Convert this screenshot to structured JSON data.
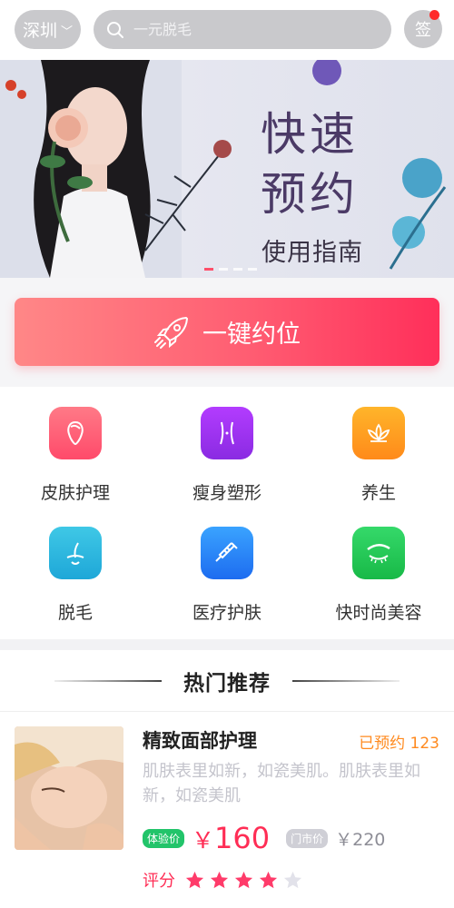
{
  "topbar": {
    "city": "深圳",
    "search_placeholder": "一元脱毛",
    "sign_label": "签"
  },
  "banner": {
    "line1": "快速",
    "line2": "预约",
    "line3": "使用指南",
    "slide_count": 4,
    "active_slide": 0
  },
  "book_button": {
    "label": "一键约位"
  },
  "categories": [
    {
      "label": "皮肤护理",
      "icon": "face-icon",
      "color_from": "#ff7a87",
      "color_to": "#ff4a6a"
    },
    {
      "label": "瘦身塑形",
      "icon": "body-icon",
      "color_from": "#b33cff",
      "color_to": "#8a2be2"
    },
    {
      "label": "养生",
      "icon": "lotus-icon",
      "color_from": "#ffb52a",
      "color_to": "#ff8a1a"
    },
    {
      "label": "脱毛",
      "icon": "hair-icon",
      "color_from": "#3fc8e6",
      "color_to": "#1ea7d8"
    },
    {
      "label": "医疗护肤",
      "icon": "syringe-icon",
      "color_from": "#3aa3ff",
      "color_to": "#1d6cf0"
    },
    {
      "label": "快时尚美容",
      "icon": "eyebrow-icon",
      "color_from": "#35d96a",
      "color_to": "#18b947"
    }
  ],
  "hot": {
    "title": "热门推荐",
    "items": [
      {
        "name": "精致面部护理",
        "booked": "已预约 123",
        "desc": "肌肤表里如新，如瓷美肌。肌肤表里如新，如瓷美肌",
        "exp_tag": "体验价",
        "currency": "￥",
        "price": "160",
        "store_tag": "门市价",
        "old_price": "￥220",
        "rating_label": "评分",
        "rating": 4,
        "rating_max": 5
      }
    ]
  },
  "colors": {
    "accent": "#ff2d55",
    "orange": "#ff8a1f",
    "green": "#22c46a"
  }
}
